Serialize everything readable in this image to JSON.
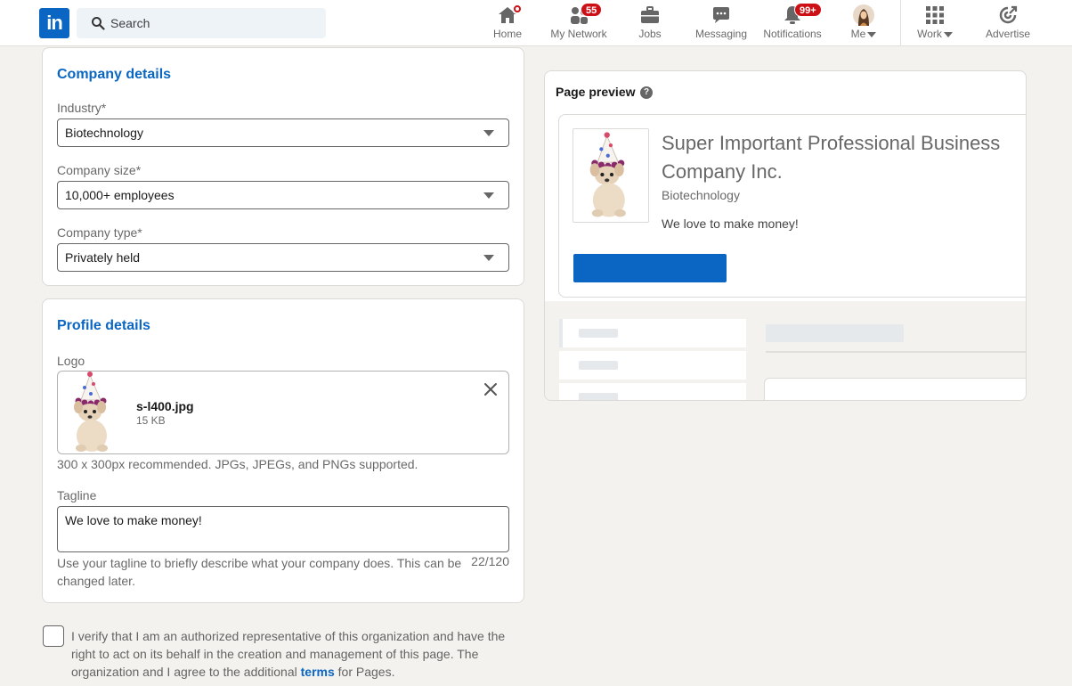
{
  "nav": {
    "logo_text": "in",
    "search_placeholder": "Search",
    "items": [
      {
        "label": "Home",
        "icon": "home-icon"
      },
      {
        "label": "My Network",
        "icon": "network-icon",
        "badge": "55"
      },
      {
        "label": "Jobs",
        "icon": "briefcase-icon"
      },
      {
        "label": "Messaging",
        "icon": "messaging-icon"
      },
      {
        "label": "Notifications",
        "icon": "bell-icon",
        "badge": "99+"
      },
      {
        "label": "Me",
        "icon": "avatar"
      },
      {
        "label": "Work",
        "icon": "grid-icon"
      },
      {
        "label": "Advertise",
        "icon": "advertise-icon"
      }
    ]
  },
  "company": {
    "title": "Company details",
    "industry_label": "Industry*",
    "industry_value": "Biotechnology",
    "size_label": "Company size*",
    "size_value": "10,000+ employees",
    "type_label": "Company type*",
    "type_value": "Privately held"
  },
  "profile": {
    "title": "Profile details",
    "logo_label": "Logo",
    "file_name": "s-l400.jpg",
    "file_size": "15 KB",
    "logo_hint": "300 x 300px recommended. JPGs, JPEGs, and PNGs supported.",
    "tagline_label": "Tagline",
    "tagline_value": "We love to make money!",
    "tagline_hint": "Use your tagline to briefly describe what your company does. This can be changed later.",
    "tagline_counter": "22/120"
  },
  "verify": {
    "text_before": "I verify that I am an authorized representative of this organization and have the right to act on its behalf in the creation and management of this page. The organization and I agree to the additional ",
    "link": "terms",
    "text_after": " for Pages."
  },
  "preview": {
    "title": "Page preview",
    "help": "?",
    "company_name": "Super Important Professional Business Company Inc.",
    "industry": "Biotechnology",
    "tagline": "We love to make money!"
  },
  "colors": {
    "brand": "#0a66c2",
    "badge": "#cc1016"
  }
}
